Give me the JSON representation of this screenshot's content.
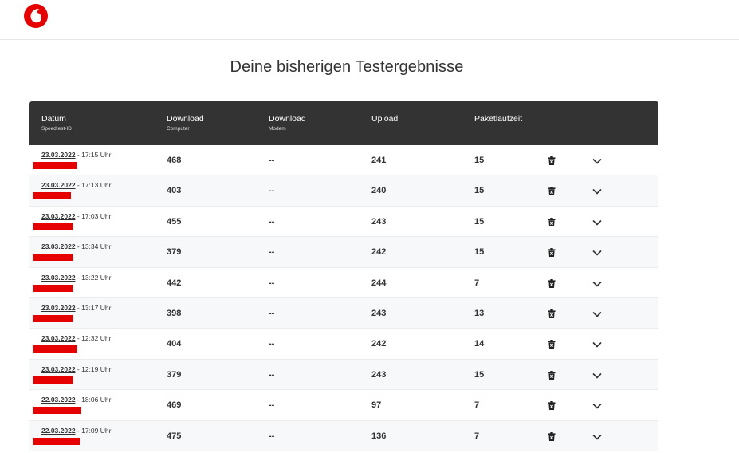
{
  "page": {
    "title": "Deine bisherigen Testergebnisse"
  },
  "columns": [
    {
      "main": "Datum",
      "sub": "Speedtest-ID"
    },
    {
      "main": "Download",
      "sub": "Computer"
    },
    {
      "main": "Download",
      "sub": "Modem"
    },
    {
      "main": "Upload",
      "sub": ""
    },
    {
      "main": "Paketlaufzeit",
      "sub": ""
    }
  ],
  "rows": [
    {
      "date": "23.03.2022",
      "time": " - 17:15 Uhr",
      "download": "468",
      "modem": "--",
      "upload": "241",
      "ping": "15"
    },
    {
      "date": "23.03.2022",
      "time": " - 17:13 Uhr",
      "download": "403",
      "modem": "--",
      "upload": "240",
      "ping": "15"
    },
    {
      "date": "23.03.2022",
      "time": " - 17:03 Uhr",
      "download": "455",
      "modem": "--",
      "upload": "243",
      "ping": "15"
    },
    {
      "date": "23.03.2022",
      "time": " - 13:34 Uhr",
      "download": "379",
      "modem": "--",
      "upload": "242",
      "ping": "15"
    },
    {
      "date": "23.03.2022",
      "time": " - 13:22 Uhr",
      "download": "442",
      "modem": "--",
      "upload": "244",
      "ping": "7"
    },
    {
      "date": "23.03.2022",
      "time": " - 13:17 Uhr",
      "download": "398",
      "modem": "--",
      "upload": "243",
      "ping": "13"
    },
    {
      "date": "23.03.2022",
      "time": " - 12:32 Uhr",
      "download": "404",
      "modem": "--",
      "upload": "242",
      "ping": "14"
    },
    {
      "date": "23.03.2022",
      "time": " - 12:19 Uhr",
      "download": "379",
      "modem": "--",
      "upload": "243",
      "ping": "15"
    },
    {
      "date": "22.03.2022",
      "time": " - 18:06 Uhr",
      "download": "469",
      "modem": "--",
      "upload": "97",
      "ping": "7"
    },
    {
      "date": "22.03.2022",
      "time": " - 17:09 Uhr",
      "download": "475",
      "modem": "--",
      "upload": "136",
      "ping": "7"
    }
  ],
  "icons": {
    "logo": "vodafone-logo",
    "delete": "trash-icon",
    "expand": "chevron-down-icon"
  },
  "colors": {
    "brand": "#e60000",
    "header_bg": "#333333"
  }
}
